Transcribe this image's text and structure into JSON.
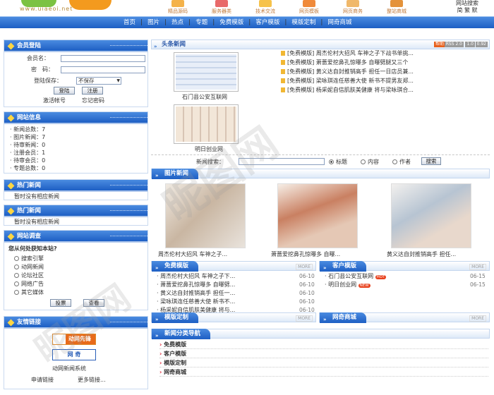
{
  "header": {
    "logo_url": "www.uiaeoi.net",
    "top_icons": [
      "精品源码",
      "服务器类",
      "技术交流",
      "网页模板",
      "网页商务",
      "整站商城"
    ],
    "right_links": [
      "网站搜索",
      "简",
      "繁",
      "默"
    ]
  },
  "nav": [
    "首页",
    "图片",
    "热点",
    "专题",
    "免费模版",
    "客户模版",
    "模版定制",
    "网奇商城"
  ],
  "login": {
    "title": "会员登陆",
    "username_label": "会员名：",
    "password_label": "密　码：",
    "save_label": "登陆保存：",
    "save_value": "不保存",
    "login_btn": "登陆",
    "register_btn": "注册",
    "activate": "激活帐号",
    "forgot": "忘记密码"
  },
  "site_info": {
    "title": "网站信息",
    "items": [
      {
        "label": "新闻总数：",
        "value": "7"
      },
      {
        "label": "图片新闻：",
        "value": "7"
      },
      {
        "label": "待审新闻：",
        "value": "0"
      },
      {
        "label": "注册会员：",
        "value": "1"
      },
      {
        "label": "待审会员：",
        "value": "0"
      },
      {
        "label": "专题总数：",
        "value": "0"
      }
    ]
  },
  "hot_news": {
    "title": "热门新闻",
    "empty": "暂时没有相应新闻"
  },
  "hot_news2": {
    "title": "热门新闻",
    "empty": "暂时没有相应新闻"
  },
  "survey": {
    "title": "网站调查",
    "question": "您从何处获知本站?",
    "options": [
      "搜索引擎",
      "动网新闻",
      "论坛社区",
      "网络广告",
      "其它媒体"
    ],
    "vote_btn": "投票",
    "view_btn": "查看"
  },
  "links": {
    "title": "友情链接",
    "logo1": "动网先锋",
    "logo2": "网 奇",
    "site": "动网新闻系统",
    "apply": "申请链接",
    "more": "更多链接..."
  },
  "headline": {
    "title": "头条新闻",
    "badges": [
      "帮助",
      "RSS 2.0",
      "1.0",
      "0.92"
    ],
    "img_caps": [
      "石门县公安互联网",
      "明日创业网"
    ],
    "items": [
      "[免费模版] 周杰伦村大招风 车神之子下战书单挑...",
      "[免费模版] 萧蔷爱挖鼻孔惊曝多 自曝劈腿又三个",
      "[免费模版] 黄义达自封推销高手 担任一日店员兼...",
      "[免费模版] 梁咏琪连任慈善大使 新书不提男友郑...",
      "[免费模版] 杨采妮自信肌肤美健康 将与梁咏琪合..."
    ]
  },
  "search": {
    "label": "新闻搜索：",
    "options": [
      "标题",
      "内容",
      "作者"
    ],
    "btn": "搜索"
  },
  "photo_news": {
    "title": "图片新闻",
    "caps": [
      "周杰伦村大招风 车神之子...",
      "萧蔷爱挖鼻孔惊曝多 自曝...",
      "黄义达自封推销高手 担任..."
    ]
  },
  "free_tpl": {
    "title": "免费模版",
    "more": "MORE",
    "items": [
      {
        "t": "周杰伦村大招风 车神之子下...",
        "d": "06-10"
      },
      {
        "t": "萧蔷爱挖鼻孔惊曝多 自曝劈...",
        "d": "06-10"
      },
      {
        "t": "黄义达自封推销高手 担任一...",
        "d": "06-10"
      },
      {
        "t": "梁咏琪连任慈善大使 新书不...",
        "d": "06-10"
      },
      {
        "t": "杨采妮自信肌肤美健康 将与...",
        "d": "06-10"
      }
    ]
  },
  "client_tpl": {
    "title": "客户模版",
    "more": "MORE",
    "items": [
      {
        "t": "石门县公安互联网",
        "tag": "HOT",
        "d": "06-15"
      },
      {
        "t": "明日创业网",
        "tag": "NEW",
        "d": "06-15"
      }
    ]
  },
  "custom_tpl": {
    "title": "模版定制",
    "more": "MORE"
  },
  "shop": {
    "title": "网奇商城",
    "more": "MORE"
  },
  "categories": {
    "title": "新闻分类导航",
    "items": [
      "免费模版",
      "客户模版",
      "模版定制",
      "网奇商城"
    ]
  },
  "watermark": "昵图网",
  "colors": {
    "nav": "#1d5fc4",
    "accent": "#f39a1e",
    "badge": "#e8601c"
  }
}
